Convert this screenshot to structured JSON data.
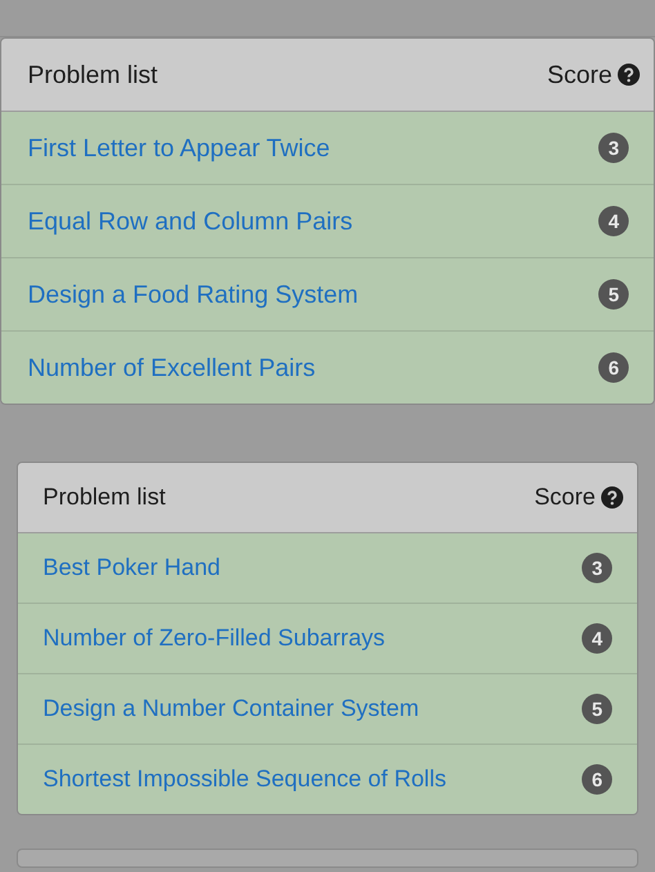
{
  "panels": [
    {
      "header": {
        "title": "Problem list",
        "score_label": "Score"
      },
      "problems": [
        {
          "title": "First Letter to Appear Twice",
          "score": "3"
        },
        {
          "title": "Equal Row and Column Pairs",
          "score": "4"
        },
        {
          "title": "Design a Food Rating System",
          "score": "5"
        },
        {
          "title": "Number of Excellent Pairs",
          "score": "6"
        }
      ]
    },
    {
      "header": {
        "title": "Problem list",
        "score_label": "Score"
      },
      "problems": [
        {
          "title": "Best Poker Hand",
          "score": "3"
        },
        {
          "title": "Number of Zero-Filled Subarrays",
          "score": "4"
        },
        {
          "title": "Design a Number Container System",
          "score": "5"
        },
        {
          "title": "Shortest Impossible Sequence of Rolls",
          "score": "6"
        }
      ]
    }
  ]
}
